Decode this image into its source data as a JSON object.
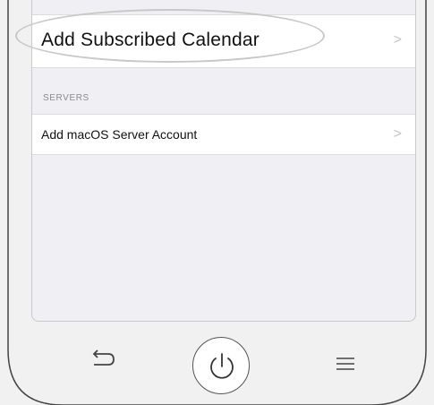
{
  "list": {
    "items": [
      {
        "label": "Add Subscribed Calendar",
        "chevron": ">"
      },
      {
        "label": "Add macOS Server Account",
        "chevron": ">"
      }
    ],
    "servers_header": "SERVERS"
  },
  "nav": {
    "icons": [
      "back-arrow-icon",
      "power-icon",
      "menu-icon"
    ]
  },
  "colors": {
    "background": "#efeff4",
    "cell": "#ffffff",
    "chevron": "#c4c4c8",
    "highlight": "#c8c8c8"
  }
}
